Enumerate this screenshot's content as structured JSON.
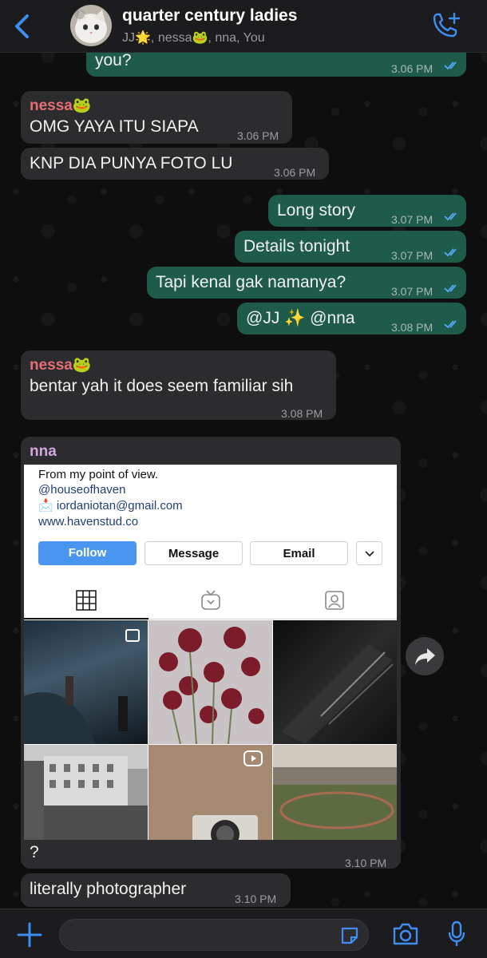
{
  "header": {
    "title": "quarter century ladies",
    "subtitle": "JJ🌟, nessa🐸, nna, You"
  },
  "messages": {
    "m1": {
      "text": "you?",
      "time": "3.06 PM"
    },
    "m2": {
      "sender": "nessa🐸",
      "text": "OMG YAYA ITU SIAPA",
      "time": "3.06 PM"
    },
    "m3": {
      "text": "KNP DIA PUNYA FOTO LU",
      "time": "3.06 PM"
    },
    "m4": {
      "text": "Long story",
      "time": "3.07 PM"
    },
    "m5": {
      "text": "Details tonight",
      "time": "3.07 PM"
    },
    "m6": {
      "text": "Tapi kenal gak namanya?",
      "time": "3.07 PM"
    },
    "m7": {
      "text": "@JJ ✨ @nna",
      "time": "3.08 PM"
    },
    "m8": {
      "sender": "nessa🐸",
      "text": "bentar yah it does seem familiar sih",
      "time": "3.08 PM"
    },
    "m9": {
      "sender": "nna",
      "caption": "?",
      "time": "3.10 PM"
    },
    "m10": {
      "text": "literally photographer",
      "time": "3.10 PM"
    }
  },
  "instagram": {
    "bio": "From my point of view.",
    "handle": "@houseofhaven",
    "email_icon": "📩",
    "email": "iordaniotan@gmail.com",
    "website": "www.havenstud.co",
    "follow_label": "Follow",
    "message_label": "Message",
    "email_label": "Email",
    "tabs": [
      "grid-icon",
      "igtv-icon",
      "tagged-icon"
    ]
  },
  "icons": {
    "back": "chevron-left-icon",
    "call": "add-call-icon",
    "share": "forward-icon",
    "plus": "plus-icon",
    "sticker": "sticker-icon",
    "camera": "camera-icon",
    "mic": "microphone-icon"
  },
  "colors": {
    "accent": "#3d8ef0",
    "outgoing_bubble": "#1f5b4a",
    "incoming_bubble": "#2c2c2e",
    "read_ticks": "#53a7f5",
    "follow_button": "#4a95f0"
  }
}
